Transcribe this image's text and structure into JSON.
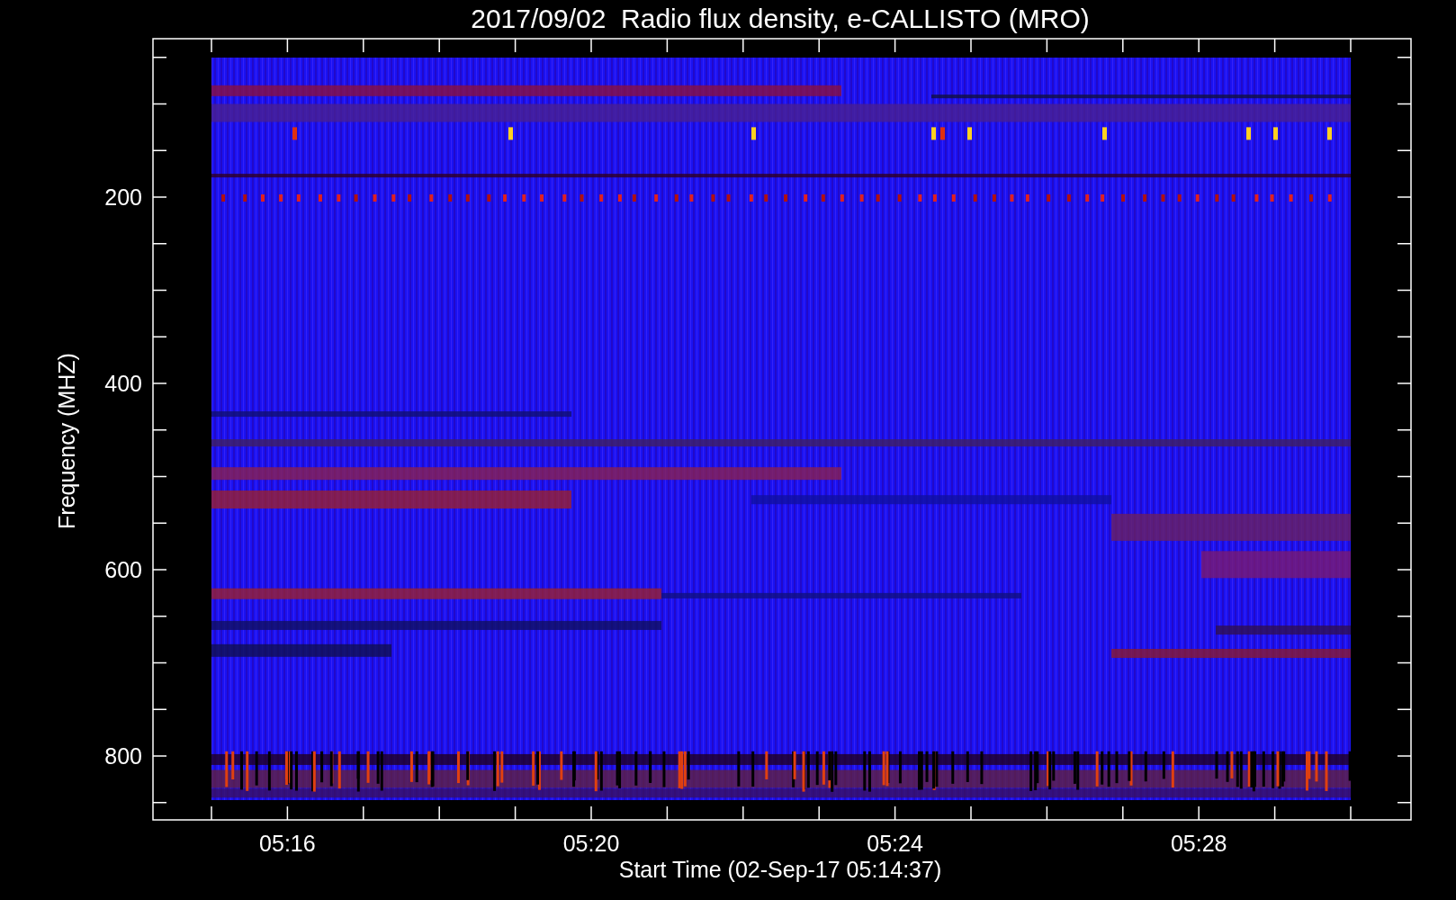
{
  "title": "2017/09/02  Radio flux density, e-CALLISTO (MRO)",
  "y_axis": {
    "label": "Frequency (MHZ)",
    "ticks": [
      "200",
      "400",
      "600",
      "800"
    ]
  },
  "x_axis": {
    "label": "Start Time (02-Sep-17 05:14:37)",
    "ticks": [
      "05:16",
      "05:20",
      "05:24",
      "05:28"
    ]
  }
}
